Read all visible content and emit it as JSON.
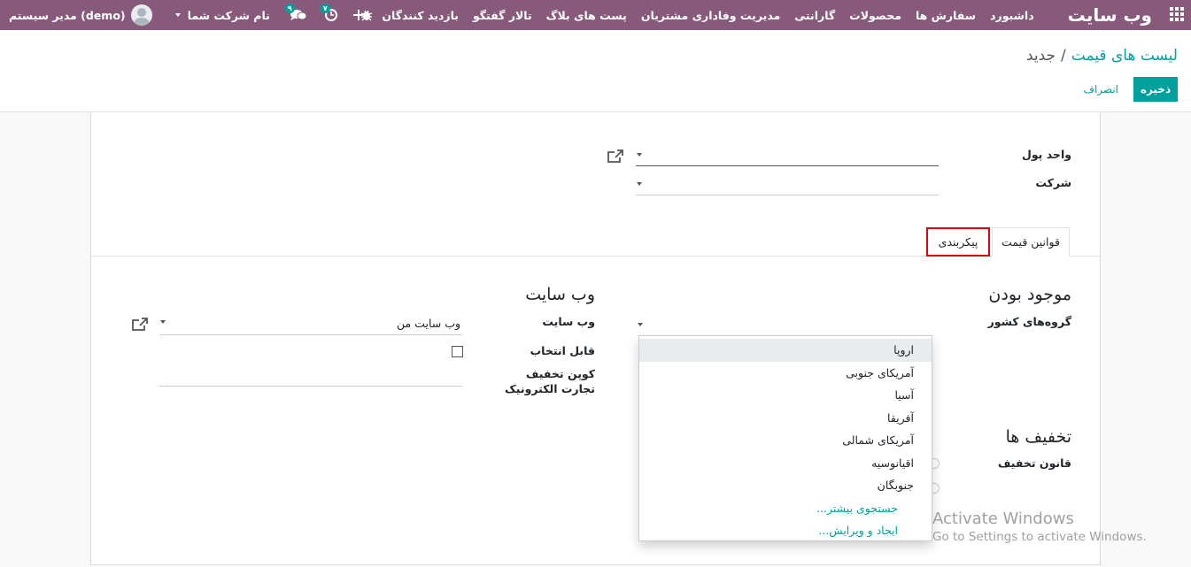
{
  "navbar": {
    "brand": "وب سایت",
    "menu": [
      "داشبورد",
      "سفارش ها",
      "محصولات",
      "گارانتی",
      "مدیریت وفاداری مشتریان",
      "پست های بلاگ",
      "تالار گفتگو",
      "بازدید کنندگان"
    ],
    "user": "مدیر سیستم (demo)",
    "company": "نام شرکت شما",
    "messages_count": "۹",
    "activities_count": "۷",
    "icons": [
      "apps-icon",
      "plus-icon",
      "bug-icon",
      "clock-icon",
      "chat-icon"
    ]
  },
  "breadcrumb": {
    "parent": "لیست های قیمت",
    "separator": "/",
    "current": "جدید"
  },
  "buttons": {
    "save": "ذخیره",
    "discard": "انصراف"
  },
  "form": {
    "currency_label": "واحد پول",
    "company_label": "شرکت",
    "tabs": [
      "قوانین قیمت",
      "پیکربندی"
    ],
    "availability_title": "موجود بودن",
    "country_groups_label": "گروه‌های کشور",
    "discounts_title": "تخفیف ها",
    "discount_rule_label": "قانون تخفیف",
    "website_title": "وب سایت",
    "website_label": "وب سایت",
    "website_value": "وب سایت من",
    "selectable_label": "قابل انتخاب",
    "ecommerce_coupon_label": "کوپن تخفیف تجارت الکترونیک"
  },
  "dropdown": {
    "options": [
      "اروپا",
      "آمریکای جنوبی",
      "آسیا",
      "آفریقا",
      "آمریکای شمالی",
      "اقیانوسیه",
      "جنوبگان"
    ],
    "search_more": "جستجوی بیشتر...",
    "create_edit": "ایجاد و ویرایش..."
  },
  "watermark": {
    "title": "Activate Windows",
    "subtitle": "Go to Settings to activate Windows."
  },
  "colors": {
    "navbar": "#875a7b",
    "accent": "#00a09d",
    "highlight": "#e3000f"
  }
}
